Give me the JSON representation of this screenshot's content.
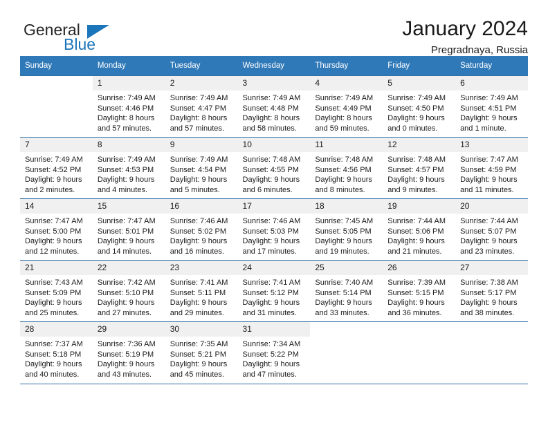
{
  "brand": {
    "name_top": "General",
    "name_bottom": "Blue",
    "accent_color": "#1b75bb"
  },
  "header": {
    "title": "January 2024",
    "subtitle": "Pregradnaya, Russia"
  },
  "theme": {
    "header_row_bg": "#3079b8",
    "daynum_bg": "#f0f0f0",
    "rule_color": "#2f6fa8",
    "text_color": "#1a1a1a"
  },
  "labels": {
    "sunrise_prefix": "Sunrise:",
    "sunset_prefix": "Sunset:",
    "daylight_prefix": "Daylight:"
  },
  "weekdays": [
    "Sunday",
    "Monday",
    "Tuesday",
    "Wednesday",
    "Thursday",
    "Friday",
    "Saturday"
  ],
  "weeks": [
    [
      {
        "day": "",
        "sunrise": "",
        "sunset": "",
        "daylight_line1": "",
        "daylight_line2": "",
        "empty": true
      },
      {
        "day": "1",
        "sunrise": "Sunrise: 7:49 AM",
        "sunset": "Sunset: 4:46 PM",
        "daylight_line1": "Daylight: 8 hours",
        "daylight_line2": "and 57 minutes."
      },
      {
        "day": "2",
        "sunrise": "Sunrise: 7:49 AM",
        "sunset": "Sunset: 4:47 PM",
        "daylight_line1": "Daylight: 8 hours",
        "daylight_line2": "and 57 minutes."
      },
      {
        "day": "3",
        "sunrise": "Sunrise: 7:49 AM",
        "sunset": "Sunset: 4:48 PM",
        "daylight_line1": "Daylight: 8 hours",
        "daylight_line2": "and 58 minutes."
      },
      {
        "day": "4",
        "sunrise": "Sunrise: 7:49 AM",
        "sunset": "Sunset: 4:49 PM",
        "daylight_line1": "Daylight: 8 hours",
        "daylight_line2": "and 59 minutes."
      },
      {
        "day": "5",
        "sunrise": "Sunrise: 7:49 AM",
        "sunset": "Sunset: 4:50 PM",
        "daylight_line1": "Daylight: 9 hours",
        "daylight_line2": "and 0 minutes."
      },
      {
        "day": "6",
        "sunrise": "Sunrise: 7:49 AM",
        "sunset": "Sunset: 4:51 PM",
        "daylight_line1": "Daylight: 9 hours",
        "daylight_line2": "and 1 minute."
      }
    ],
    [
      {
        "day": "7",
        "sunrise": "Sunrise: 7:49 AM",
        "sunset": "Sunset: 4:52 PM",
        "daylight_line1": "Daylight: 9 hours",
        "daylight_line2": "and 2 minutes."
      },
      {
        "day": "8",
        "sunrise": "Sunrise: 7:49 AM",
        "sunset": "Sunset: 4:53 PM",
        "daylight_line1": "Daylight: 9 hours",
        "daylight_line2": "and 4 minutes."
      },
      {
        "day": "9",
        "sunrise": "Sunrise: 7:49 AM",
        "sunset": "Sunset: 4:54 PM",
        "daylight_line1": "Daylight: 9 hours",
        "daylight_line2": "and 5 minutes."
      },
      {
        "day": "10",
        "sunrise": "Sunrise: 7:48 AM",
        "sunset": "Sunset: 4:55 PM",
        "daylight_line1": "Daylight: 9 hours",
        "daylight_line2": "and 6 minutes."
      },
      {
        "day": "11",
        "sunrise": "Sunrise: 7:48 AM",
        "sunset": "Sunset: 4:56 PM",
        "daylight_line1": "Daylight: 9 hours",
        "daylight_line2": "and 8 minutes."
      },
      {
        "day": "12",
        "sunrise": "Sunrise: 7:48 AM",
        "sunset": "Sunset: 4:57 PM",
        "daylight_line1": "Daylight: 9 hours",
        "daylight_line2": "and 9 minutes."
      },
      {
        "day": "13",
        "sunrise": "Sunrise: 7:47 AM",
        "sunset": "Sunset: 4:59 PM",
        "daylight_line1": "Daylight: 9 hours",
        "daylight_line2": "and 11 minutes."
      }
    ],
    [
      {
        "day": "14",
        "sunrise": "Sunrise: 7:47 AM",
        "sunset": "Sunset: 5:00 PM",
        "daylight_line1": "Daylight: 9 hours",
        "daylight_line2": "and 12 minutes."
      },
      {
        "day": "15",
        "sunrise": "Sunrise: 7:47 AM",
        "sunset": "Sunset: 5:01 PM",
        "daylight_line1": "Daylight: 9 hours",
        "daylight_line2": "and 14 minutes."
      },
      {
        "day": "16",
        "sunrise": "Sunrise: 7:46 AM",
        "sunset": "Sunset: 5:02 PM",
        "daylight_line1": "Daylight: 9 hours",
        "daylight_line2": "and 16 minutes."
      },
      {
        "day": "17",
        "sunrise": "Sunrise: 7:46 AM",
        "sunset": "Sunset: 5:03 PM",
        "daylight_line1": "Daylight: 9 hours",
        "daylight_line2": "and 17 minutes."
      },
      {
        "day": "18",
        "sunrise": "Sunrise: 7:45 AM",
        "sunset": "Sunset: 5:05 PM",
        "daylight_line1": "Daylight: 9 hours",
        "daylight_line2": "and 19 minutes."
      },
      {
        "day": "19",
        "sunrise": "Sunrise: 7:44 AM",
        "sunset": "Sunset: 5:06 PM",
        "daylight_line1": "Daylight: 9 hours",
        "daylight_line2": "and 21 minutes."
      },
      {
        "day": "20",
        "sunrise": "Sunrise: 7:44 AM",
        "sunset": "Sunset: 5:07 PM",
        "daylight_line1": "Daylight: 9 hours",
        "daylight_line2": "and 23 minutes."
      }
    ],
    [
      {
        "day": "21",
        "sunrise": "Sunrise: 7:43 AM",
        "sunset": "Sunset: 5:09 PM",
        "daylight_line1": "Daylight: 9 hours",
        "daylight_line2": "and 25 minutes."
      },
      {
        "day": "22",
        "sunrise": "Sunrise: 7:42 AM",
        "sunset": "Sunset: 5:10 PM",
        "daylight_line1": "Daylight: 9 hours",
        "daylight_line2": "and 27 minutes."
      },
      {
        "day": "23",
        "sunrise": "Sunrise: 7:41 AM",
        "sunset": "Sunset: 5:11 PM",
        "daylight_line1": "Daylight: 9 hours",
        "daylight_line2": "and 29 minutes."
      },
      {
        "day": "24",
        "sunrise": "Sunrise: 7:41 AM",
        "sunset": "Sunset: 5:12 PM",
        "daylight_line1": "Daylight: 9 hours",
        "daylight_line2": "and 31 minutes."
      },
      {
        "day": "25",
        "sunrise": "Sunrise: 7:40 AM",
        "sunset": "Sunset: 5:14 PM",
        "daylight_line1": "Daylight: 9 hours",
        "daylight_line2": "and 33 minutes."
      },
      {
        "day": "26",
        "sunrise": "Sunrise: 7:39 AM",
        "sunset": "Sunset: 5:15 PM",
        "daylight_line1": "Daylight: 9 hours",
        "daylight_line2": "and 36 minutes."
      },
      {
        "day": "27",
        "sunrise": "Sunrise: 7:38 AM",
        "sunset": "Sunset: 5:17 PM",
        "daylight_line1": "Daylight: 9 hours",
        "daylight_line2": "and 38 minutes."
      }
    ],
    [
      {
        "day": "28",
        "sunrise": "Sunrise: 7:37 AM",
        "sunset": "Sunset: 5:18 PM",
        "daylight_line1": "Daylight: 9 hours",
        "daylight_line2": "and 40 minutes."
      },
      {
        "day": "29",
        "sunrise": "Sunrise: 7:36 AM",
        "sunset": "Sunset: 5:19 PM",
        "daylight_line1": "Daylight: 9 hours",
        "daylight_line2": "and 43 minutes."
      },
      {
        "day": "30",
        "sunrise": "Sunrise: 7:35 AM",
        "sunset": "Sunset: 5:21 PM",
        "daylight_line1": "Daylight: 9 hours",
        "daylight_line2": "and 45 minutes."
      },
      {
        "day": "31",
        "sunrise": "Sunrise: 7:34 AM",
        "sunset": "Sunset: 5:22 PM",
        "daylight_line1": "Daylight: 9 hours",
        "daylight_line2": "and 47 minutes."
      },
      {
        "day": "",
        "sunrise": "",
        "sunset": "",
        "daylight_line1": "",
        "daylight_line2": "",
        "empty": true
      },
      {
        "day": "",
        "sunrise": "",
        "sunset": "",
        "daylight_line1": "",
        "daylight_line2": "",
        "empty": true
      },
      {
        "day": "",
        "sunrise": "",
        "sunset": "",
        "daylight_line1": "",
        "daylight_line2": "",
        "empty": true
      }
    ]
  ]
}
